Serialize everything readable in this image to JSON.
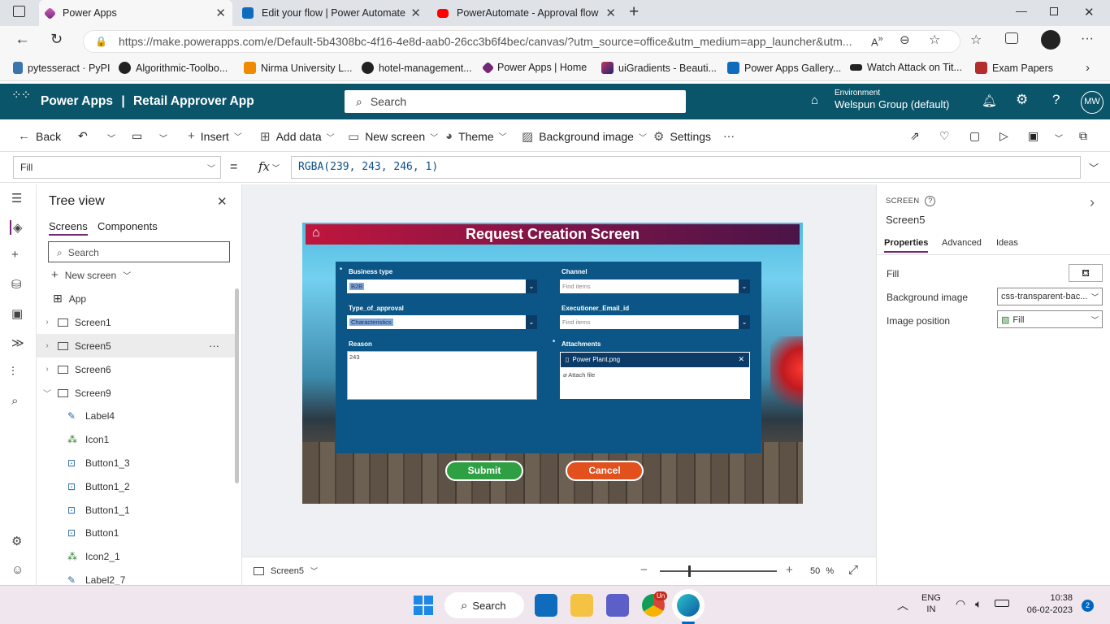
{
  "browser": {
    "tabs": [
      {
        "title": "Power Apps",
        "active": true
      },
      {
        "title": "Edit your flow | Power Automate",
        "active": false
      },
      {
        "title": "PowerAutomate - Approval flow",
        "active": false
      }
    ],
    "url": "https://make.powerapps.com/e/Default-5b4308bc-4f16-4e8d-aab0-26cc3b6f4bec/canvas/?utm_source=office&utm_medium=app_launcher&utm...",
    "bookmarks": [
      "pytesseract · PyPI",
      "Algorithmic-Toolbo...",
      "Nirma University L...",
      "hotel-management...",
      "Power Apps | Home",
      "uiGradients - Beauti...",
      "Power Apps Gallery...",
      "Watch Attack on Tit...",
      "Exam Papers"
    ]
  },
  "header": {
    "app": "Power Apps",
    "separator": "|",
    "project": "Retail Approver App",
    "search_placeholder": "Search",
    "env_label": "Environment",
    "env_name": "Welspun Group (default)",
    "avatar": "MW"
  },
  "command_bar": {
    "back": "Back",
    "insert": "Insert",
    "add_data": "Add data",
    "new_screen": "New screen",
    "theme": "Theme",
    "background_image": "Background image",
    "settings": "Settings",
    "more": "···"
  },
  "formula_bar": {
    "property": "Fill",
    "equals": "=",
    "fx": "fx",
    "formula": "RGBA(239, 243, 246, 1)"
  },
  "tree_view": {
    "title": "Tree view",
    "tabs": [
      "Screens",
      "Components"
    ],
    "search_placeholder": "Search",
    "new_screen": "New screen",
    "app_label": "App",
    "screens": [
      "Screen1",
      "Screen5",
      "Screen6",
      "Screen9"
    ],
    "controls": [
      "Label4",
      "Icon1",
      "Button1_3",
      "Button1_2",
      "Button1_1",
      "Button1",
      "Icon2_1",
      "Label2_7"
    ],
    "selected_more": "···"
  },
  "app_screen": {
    "title": "Request Creation Screen",
    "fields": {
      "business_type_label": "Business type",
      "business_type_value": "B2B",
      "channel_label": "Channel",
      "channel_placeholder": "Find items",
      "type_of_approval_label": "Type_of_approval",
      "type_of_approval_value": "Characteristics",
      "executioner_label": "Executioner_Email_id",
      "executioner_placeholder": "Find items",
      "reason_label": "Reason",
      "reason_value": "243",
      "attachments_label": "Attachments",
      "attachment_file": "Power Plant.png",
      "attach_file": "Attach file",
      "required_mark": "*"
    },
    "submit": "Submit",
    "cancel": "Cancel",
    "colors": {
      "submit": "#2ea043",
      "cancel": "#e1501d",
      "form": "#0b5686"
    }
  },
  "canvas_footer": {
    "screen": "Screen5",
    "zoom": "50",
    "zoom_unit": "%"
  },
  "properties_panel": {
    "type": "SCREEN",
    "name": "Screen5",
    "tabs": [
      "Properties",
      "Advanced",
      "Ideas"
    ],
    "fill_label": "Fill",
    "background_image_label": "Background image",
    "background_image_value": "css-transparent-bac...",
    "image_position_label": "Image position",
    "image_position_value": "Fill"
  },
  "taskbar": {
    "search": "Search",
    "lang1": "ENG",
    "lang2": "IN",
    "time": "10:38",
    "date": "06-02-2023",
    "notifications": "2",
    "chrome_badge": "Un"
  }
}
